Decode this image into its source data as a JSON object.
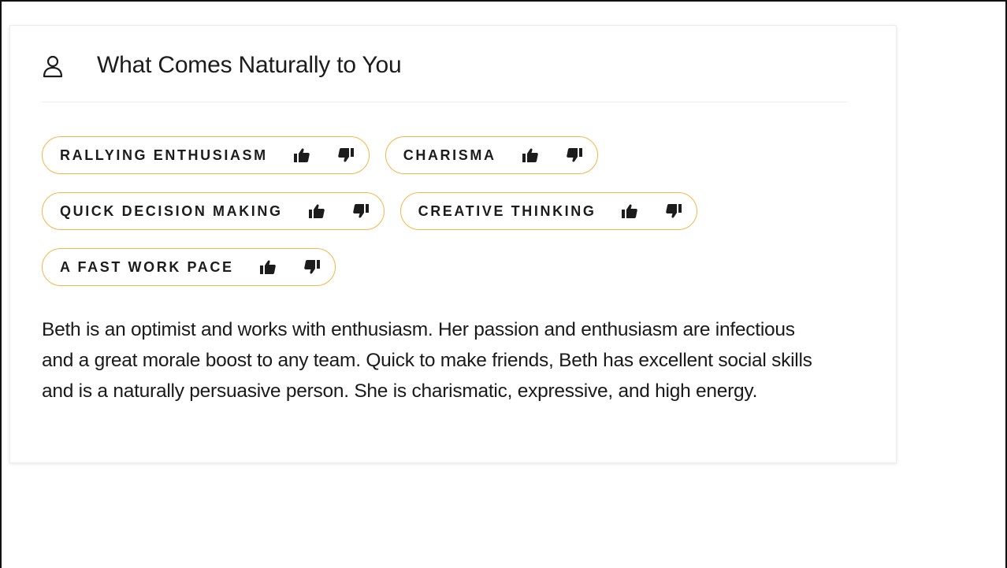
{
  "section": {
    "title": "What Comes Naturally to You",
    "icon": "user-icon"
  },
  "traits": [
    {
      "label": "RALLYING ENTHUSIASM",
      "like_icon": "thumbs-up-icon",
      "dislike_icon": "thumbs-down-icon"
    },
    {
      "label": "CHARISMA",
      "like_icon": "thumbs-up-icon",
      "dislike_icon": "thumbs-down-icon"
    },
    {
      "label": "QUICK DECISION MAKING",
      "like_icon": "thumbs-up-icon",
      "dislike_icon": "thumbs-down-icon"
    },
    {
      "label": "CREATIVE THINKING",
      "like_icon": "thumbs-up-icon",
      "dislike_icon": "thumbs-down-icon"
    },
    {
      "label": "A FAST WORK PACE",
      "like_icon": "thumbs-up-icon",
      "dislike_icon": "thumbs-down-icon"
    }
  ],
  "description": "Beth is an optimist and works with enthusiasm. Her passion and enthusiasm are infectious and a great morale boost to any team. Quick to make friends, Beth has excellent social skills and is a naturally persuasive person. She is charismatic, expressive, and high energy.",
  "colors": {
    "chip_border": "#f5b54a",
    "text": "#1c1c1c",
    "card_border": "#ececec"
  }
}
